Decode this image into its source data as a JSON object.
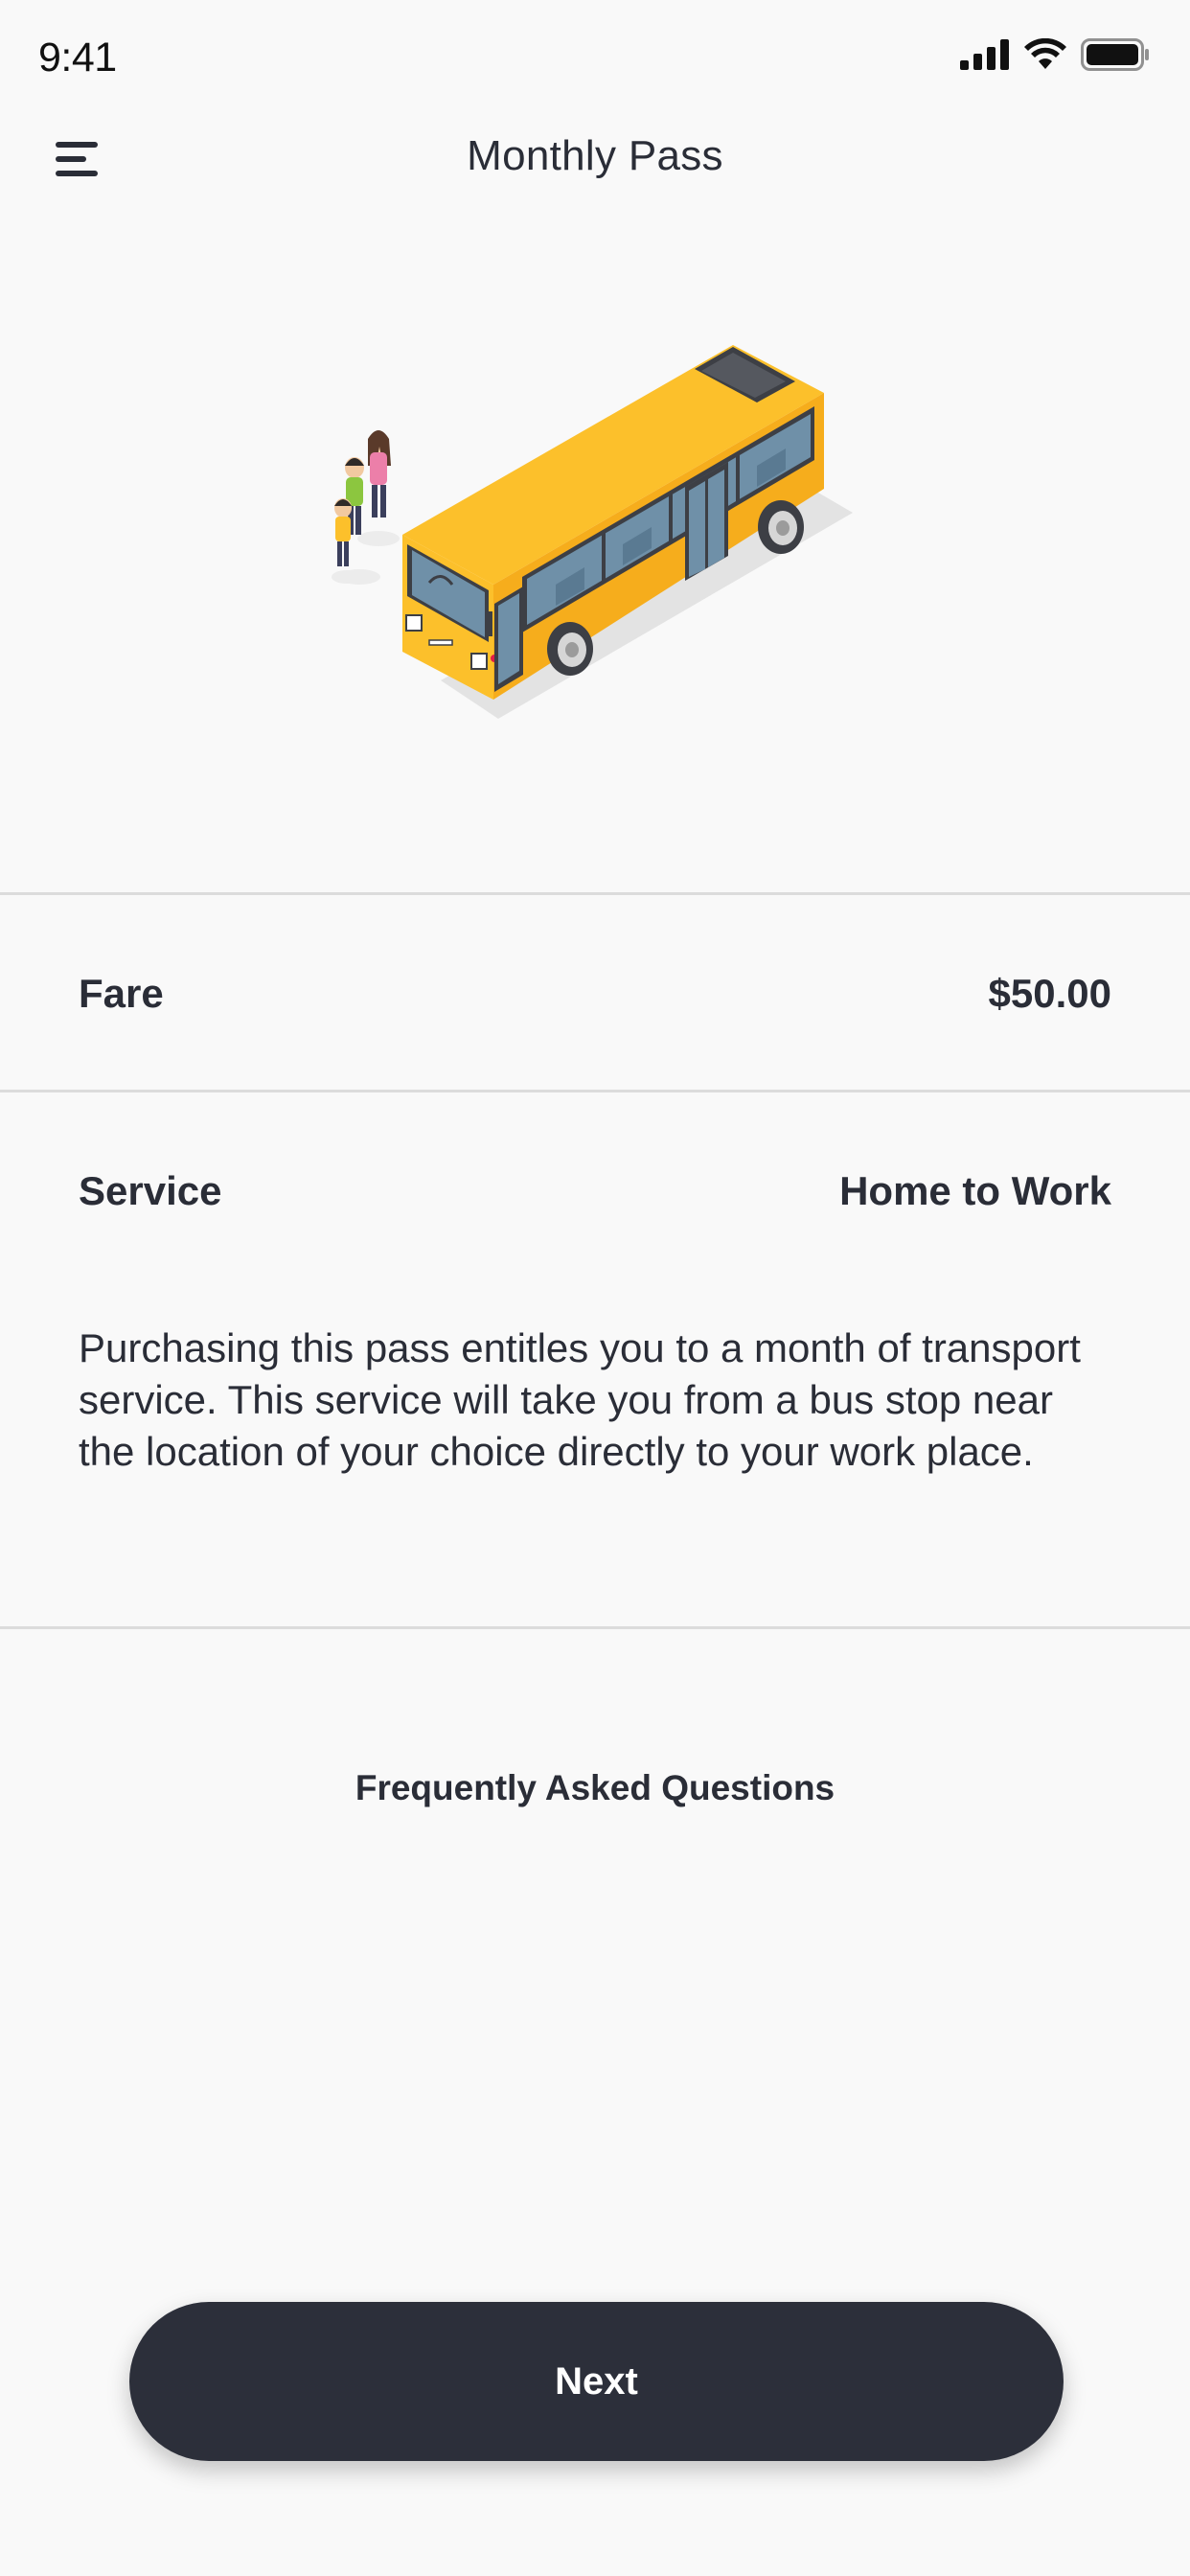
{
  "status_bar": {
    "time": "9:41",
    "icons": [
      "cellular-signal-icon",
      "wifi-icon",
      "battery-icon"
    ]
  },
  "header": {
    "menu_icon": "hamburger-menu-icon",
    "title": "Monthly Pass"
  },
  "illustration": {
    "subject": "bus-with-passengers-illustration",
    "colors": {
      "bus_body": "#fbbf24",
      "bus_shadow": "#f59e0b",
      "windows": "#6b8fa8",
      "ground_shadow": "#e0e0e0"
    }
  },
  "details": {
    "fare_label": "Fare",
    "fare_value": "$50.00",
    "service_label": "Service",
    "service_value": "Home to Work",
    "description": "Purchasing this pass entitles you to a month of transport service. This service will take you from a bus stop near the location of your choice directly to your work place."
  },
  "faq": {
    "label": "Frequently Asked Questions"
  },
  "actions": {
    "next_label": "Next"
  },
  "colors": {
    "background": "#f9f9f9",
    "text": "#2a2d37",
    "button": "#2c2f3a",
    "divider": "#dcdcdc"
  }
}
